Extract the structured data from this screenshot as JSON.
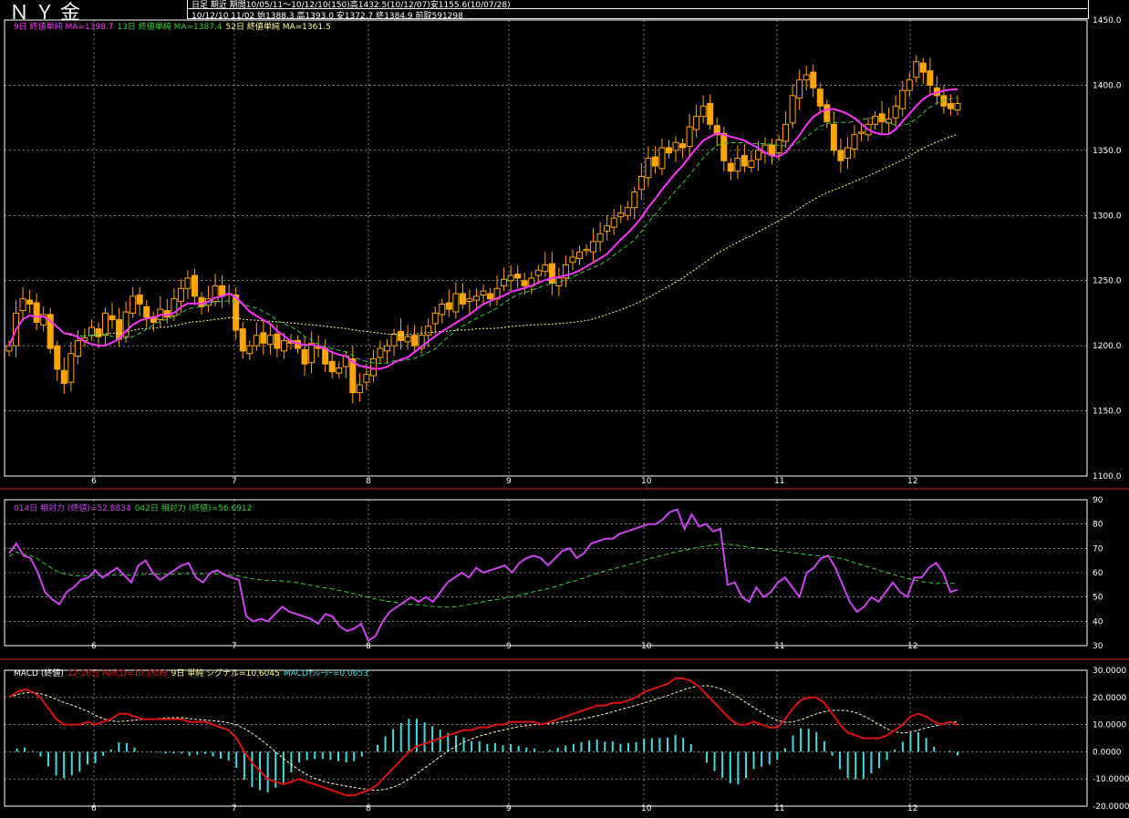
{
  "header": {
    "title": "ＮＹ金",
    "line1": "日足 期近 期間10/05/11～10/12/10(150)高1432.5(10/12/07)安1155.6(10/07/28)",
    "line2": "10/12/10 11/02 始1388.3 高1393.0 安1372.7 終1384.9 前取591298"
  },
  "colors": {
    "background": "#000000",
    "up_candle": "#000000",
    "down_candle": "#ffa500",
    "ma9": "#ff33ff",
    "ma13": "#33cc33",
    "ma52": "#ffff88",
    "rsi14": "#cc44ee",
    "rsi42": "#33cc33",
    "macd": "#dd1111",
    "signal": "#ffffcc",
    "osc": "#44dddd",
    "grid": "#ffffff",
    "separator": "#cc2222"
  },
  "x_month_labels": [
    "6",
    "7",
    "8",
    "9",
    "10",
    "11",
    "12"
  ],
  "legends": {
    "price": [
      {
        "text": "9日 終値単純 MA=1398.7",
        "color": "#ff33ff"
      },
      {
        "text": "13日 終値単純 MA=1387.4",
        "color": "#33cc33"
      },
      {
        "text": "52日 終値単純 MA=1361.5",
        "color": "#ffff88"
      }
    ],
    "rsi": [
      {
        "text": "014日 相対力 (終値)=52.8834",
        "color": "#cc44ee"
      },
      {
        "text": "042日 相対力 (終値)=56.6912",
        "color": "#33cc33"
      }
    ],
    "macd": [
      {
        "text": "MACD (終値)",
        "color": "#ffffff"
      },
      {
        "text": "12-26日 MACD=10.6698",
        "color": "#dd1111"
      },
      {
        "text": "9日 単純 シグナル=10.6045",
        "color": "#ffff88"
      },
      {
        "text": "MACDｵｼﾚｰﾀｰ=0.0653",
        "color": "#44dddd"
      }
    ]
  },
  "chart_data": [
    {
      "type": "candlestick",
      "title": "ＮＹ金",
      "y_ticks": [
        "1450.0",
        "1400.0",
        "1350.0",
        "1300.0",
        "1250.0",
        "1200.0",
        "1150.0",
        "1100.0"
      ],
      "ylim": [
        1100,
        1450
      ],
      "x_month_labels": [
        "6",
        "7",
        "8",
        "9",
        "10",
        "11",
        "12"
      ],
      "close_series": [
        1200,
        1225,
        1236,
        1232,
        1218,
        1224,
        1198,
        1182,
        1171,
        1194,
        1204,
        1206,
        1214,
        1207,
        1225,
        1220,
        1205,
        1226,
        1238,
        1232,
        1222,
        1218,
        1228,
        1222,
        1236,
        1244,
        1252,
        1238,
        1230,
        1236,
        1246,
        1238,
        1240,
        1212,
        1196,
        1200,
        1208,
        1202,
        1208,
        1198,
        1204,
        1202,
        1198,
        1186,
        1202,
        1198,
        1186,
        1180,
        1183,
        1192,
        1164,
        1170,
        1178,
        1190,
        1198,
        1200,
        1209,
        1204,
        1207,
        1200,
        1208,
        1215,
        1225,
        1232,
        1228,
        1240,
        1232,
        1236,
        1238,
        1242,
        1236,
        1244,
        1251,
        1254,
        1252,
        1246,
        1252,
        1258,
        1262,
        1248,
        1252,
        1262,
        1268,
        1272,
        1274,
        1280,
        1286,
        1292,
        1298,
        1302,
        1306,
        1318,
        1330,
        1344,
        1338,
        1352,
        1348,
        1356,
        1352,
        1368,
        1376,
        1384,
        1370,
        1362,
        1342,
        1334,
        1344,
        1338,
        1342,
        1350,
        1354,
        1346,
        1358,
        1370,
        1392,
        1404,
        1408,
        1398,
        1384,
        1372,
        1350,
        1342,
        1352,
        1362,
        1364,
        1370,
        1376,
        1372,
        1374,
        1384,
        1396,
        1404,
        1418,
        1410,
        1400,
        1392,
        1384,
        1382,
        1386
      ],
      "series": [
        {
          "name": "9日 終値単純 MA",
          "last": 1398.7
        },
        {
          "name": "13日 終値単純 MA",
          "last": 1387.4
        },
        {
          "name": "52日 終値単純 MA",
          "last": 1361.5
        }
      ],
      "last_bar": {
        "open": 1388.3,
        "high": 1393.0,
        "low": 1372.7,
        "close": 1384.9
      }
    },
    {
      "type": "line",
      "y_ticks": [
        "90",
        "80",
        "70",
        "60",
        "50",
        "40",
        "30"
      ],
      "ylim": [
        30,
        90
      ],
      "series": [
        {
          "name": "014日 相対力 (終値)",
          "last": 52.8834,
          "values": [
            68,
            72,
            67,
            66,
            60,
            52,
            49,
            47,
            52,
            54,
            57,
            58,
            61,
            58,
            60,
            62,
            59,
            56,
            63,
            65,
            60,
            57,
            59,
            61,
            63,
            64,
            58,
            56,
            60,
            61,
            59,
            58,
            57,
            42,
            40,
            41,
            40,
            43,
            46,
            44,
            43,
            42,
            41,
            39,
            43,
            42,
            38,
            36,
            37,
            39,
            32,
            34,
            40,
            44,
            46,
            48,
            50,
            48,
            50,
            48,
            52,
            56,
            58,
            60,
            58,
            62,
            60,
            61,
            62,
            63,
            60,
            64,
            66,
            67,
            66,
            63,
            66,
            69,
            70,
            66,
            68,
            72,
            73,
            74,
            74,
            76,
            77,
            78,
            79,
            80,
            80,
            82,
            85,
            86,
            78,
            84,
            79,
            80,
            77,
            78,
            55,
            56,
            50,
            48,
            54,
            50,
            52,
            56,
            58,
            54,
            50,
            60,
            62,
            66,
            67,
            62,
            55,
            48,
            44,
            46,
            50,
            48,
            52,
            56,
            52,
            50,
            58,
            58,
            62,
            64,
            60,
            52,
            53
          ]
        },
        {
          "name": "042日 相対力 (終値)",
          "last": 56.6912
        }
      ]
    },
    {
      "type": "line",
      "title": "MACD (終値)",
      "y_ticks": [
        "30.0000",
        "20.0000",
        "10.0000",
        "0.0000",
        "-10.0000",
        "-20.0000"
      ],
      "ylim": [
        -20,
        30
      ],
      "series": [
        {
          "name": "12-26日 MACD",
          "last": 10.6698,
          "values": [
            20,
            22,
            23,
            22,
            20,
            16,
            12,
            10,
            10,
            10,
            11,
            10,
            11,
            12,
            14,
            14,
            13,
            12,
            12,
            12,
            12,
            12,
            12,
            11,
            11,
            11,
            10,
            9,
            8,
            5,
            0,
            -4,
            -7,
            -10,
            -11,
            -12,
            -11,
            -10,
            -11,
            -12,
            -13,
            -14,
            -15,
            -16,
            -16,
            -15,
            -14,
            -12,
            -9,
            -6,
            -3,
            0,
            2,
            3,
            4,
            5,
            6,
            7,
            8,
            8,
            9,
            9,
            10,
            10,
            11,
            11,
            11,
            11,
            10,
            11,
            12,
            13,
            14,
            15,
            16,
            17,
            17,
            18,
            18,
            19,
            20,
            22,
            23,
            24,
            25,
            27,
            27,
            26,
            24,
            21,
            18,
            15,
            12,
            10,
            10,
            11,
            10,
            9,
            9,
            12,
            16,
            19,
            20,
            20,
            18,
            14,
            10,
            7,
            6,
            5,
            5,
            5,
            6,
            8,
            10,
            13,
            14,
            13,
            11,
            10,
            11,
            10
          ]
        },
        {
          "name": "9日 単純 シグナル",
          "last": 10.6045
        },
        {
          "name": "MACDｵｼﾚｰﾀｰ",
          "last": 0.0653
        }
      ]
    }
  ]
}
